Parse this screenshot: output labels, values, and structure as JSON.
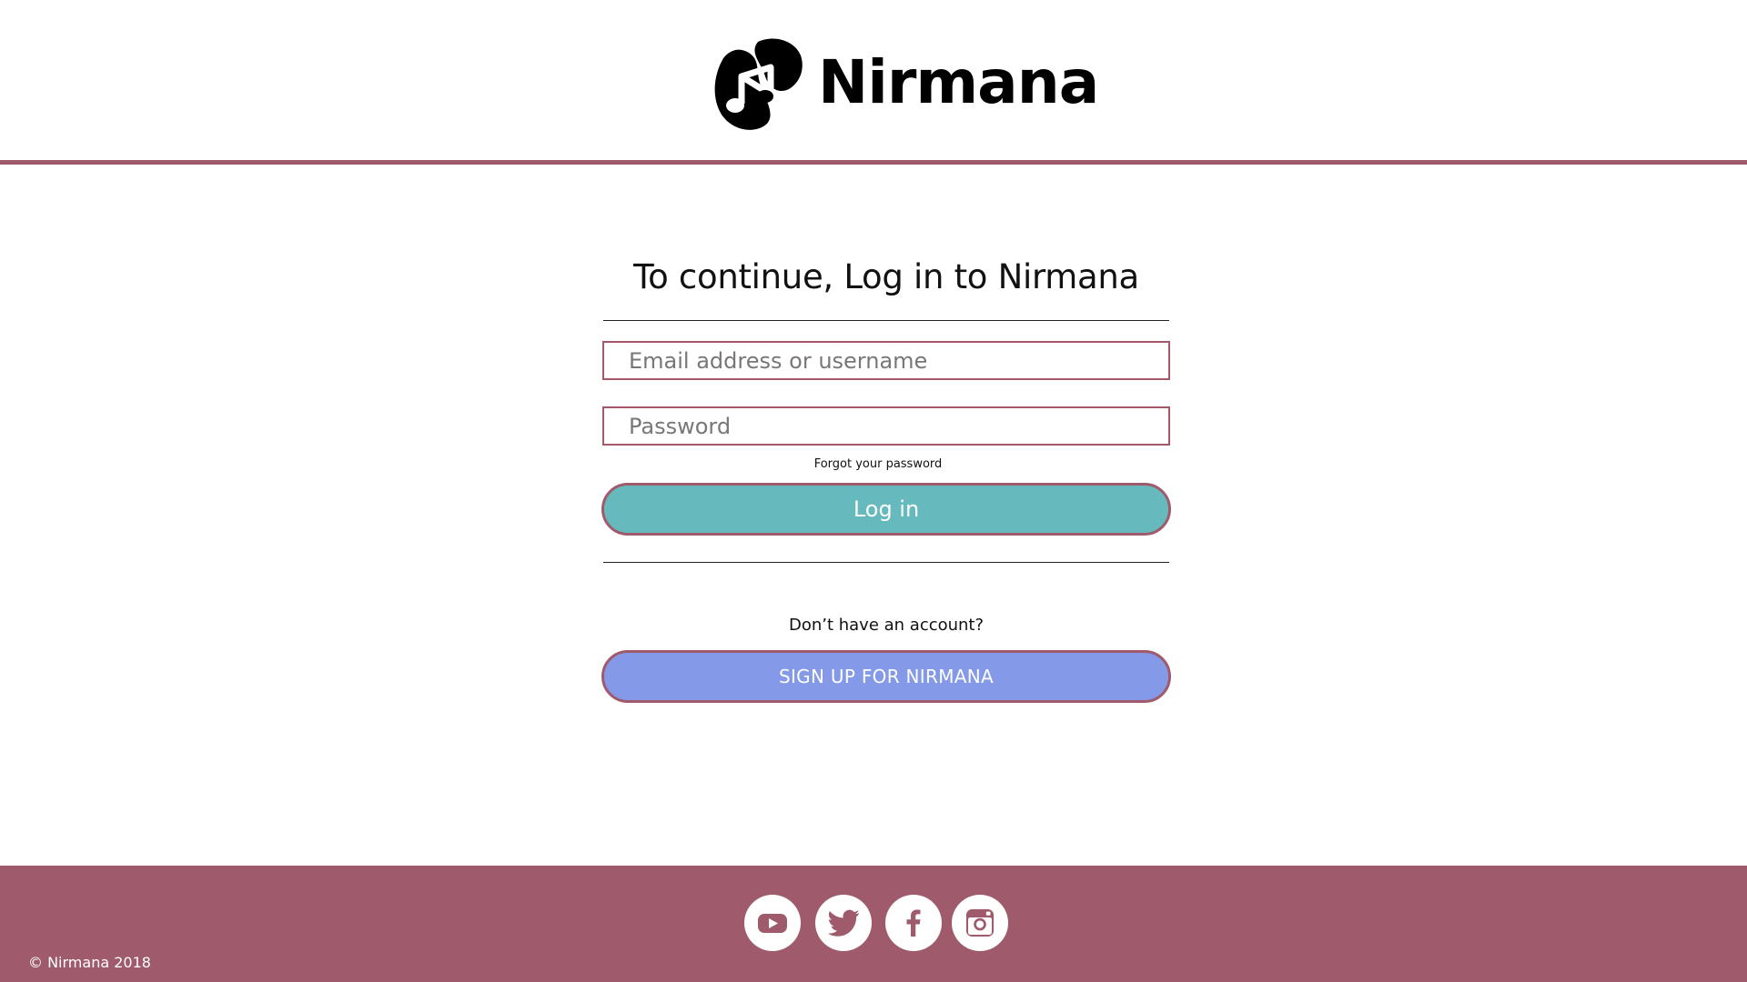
{
  "brand": {
    "name": "Nirmana",
    "accent_color": "#9f5b6b"
  },
  "login": {
    "title": "To continue, Log in to Nirmana",
    "email_placeholder": "Email address or username",
    "password_placeholder": "Password",
    "forgot_link": "Forgot your password",
    "login_button": "Log in",
    "login_button_color": "#66b9bd"
  },
  "signup": {
    "prompt": "Don’t have an account?",
    "button": "SIGN UP FOR NIRMANA",
    "button_color": "#8499e8"
  },
  "footer": {
    "copyright": "© Nirmana 2018",
    "social": [
      {
        "icon": "youtube-icon"
      },
      {
        "icon": "twitter-icon"
      },
      {
        "icon": "facebook-icon"
      },
      {
        "icon": "instagram-icon"
      }
    ]
  }
}
